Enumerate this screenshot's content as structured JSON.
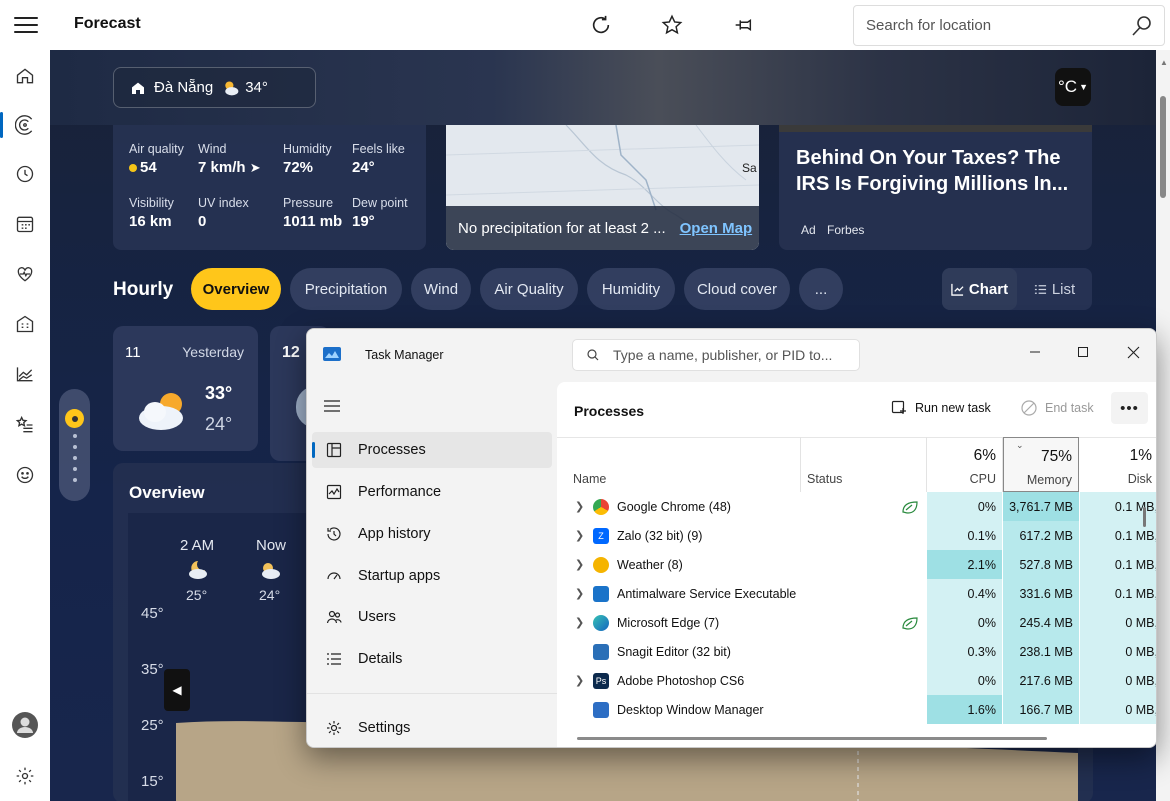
{
  "app": {
    "title": "Forecast"
  },
  "search": {
    "placeholder": "Search for location"
  },
  "location": {
    "name": "Đà Nẵng",
    "temp": "34°"
  },
  "unit": {
    "label": "°C"
  },
  "metrics": [
    {
      "label": "Air quality",
      "value": "54"
    },
    {
      "label": "Wind",
      "value": "7 km/h"
    },
    {
      "label": "Humidity",
      "value": "72%"
    },
    {
      "label": "Feels like",
      "value": "24°"
    },
    {
      "label": "Visibility",
      "value": "16 km"
    },
    {
      "label": "UV index",
      "value": "0"
    },
    {
      "label": "Pressure",
      "value": "1011 mb"
    },
    {
      "label": "Dew point",
      "value": "19°"
    }
  ],
  "map": {
    "text": "No precipitation for at least 2 ...",
    "link": "Open Map"
  },
  "news": {
    "headline": "Behind On Your Taxes? The IRS Is Forgiving Millions In...",
    "ad": "Ad",
    "source": "Forbes"
  },
  "hourly": {
    "title": "Hourly",
    "tabs": [
      "Overview",
      "Precipitation",
      "Wind",
      "Air Quality",
      "Humidity",
      "Cloud cover",
      "..."
    ],
    "view": {
      "chart": "Chart",
      "list": "List"
    }
  },
  "daycards": [
    {
      "day": "11",
      "label": "Yesterday",
      "high": "33°",
      "low": "24°"
    },
    {
      "day": "12"
    }
  ],
  "overview": {
    "title": "Overview",
    "hours": [
      {
        "time": "2 AM",
        "temp": "25°"
      },
      {
        "time": "Now",
        "temp": "24°"
      }
    ],
    "yticks": [
      "45°",
      "35°",
      "25°",
      "15°"
    ]
  },
  "taskmanager": {
    "title": "Task Manager",
    "search_placeholder": "Type a name, publisher, or PID to...",
    "nav": [
      "Processes",
      "Performance",
      "App history",
      "Startup apps",
      "Users",
      "Details",
      "Settings"
    ],
    "header": {
      "title": "Processes",
      "run": "Run new task",
      "end": "End task"
    },
    "columns": {
      "name": "Name",
      "status": "Status",
      "cpu": {
        "pct": "6%",
        "cap": "CPU"
      },
      "memory": {
        "pct": "75%",
        "cap": "Memory"
      },
      "disk": {
        "pct": "1%",
        "cap": "Disk"
      }
    },
    "rows": [
      {
        "name": "Google Chrome (48)",
        "cpu": "0%",
        "mem": "3,761.7 MB",
        "disk": "0.1 MB,",
        "expand": true,
        "eco": true
      },
      {
        "name": "Zalo (32 bit) (9)",
        "cpu": "0.1%",
        "mem": "617.2 MB",
        "disk": "0.1 MB,",
        "expand": true,
        "eco": false
      },
      {
        "name": "Weather (8)",
        "cpu": "2.1%",
        "mem": "527.8 MB",
        "disk": "0.1 MB,",
        "expand": true,
        "eco": false
      },
      {
        "name": "Antimalware Service Executable",
        "cpu": "0.4%",
        "mem": "331.6 MB",
        "disk": "0.1 MB,",
        "expand": true,
        "eco": false
      },
      {
        "name": "Microsoft Edge (7)",
        "cpu": "0%",
        "mem": "245.4 MB",
        "disk": "0 MB,",
        "expand": true,
        "eco": true
      },
      {
        "name": "Snagit Editor (32 bit)",
        "cpu": "0.3%",
        "mem": "238.1 MB",
        "disk": "0 MB,",
        "expand": false,
        "eco": false
      },
      {
        "name": "Adobe Photoshop CS6",
        "cpu": "0%",
        "mem": "217.6 MB",
        "disk": "0 MB,",
        "expand": true,
        "eco": false
      },
      {
        "name": "Desktop Window Manager",
        "cpu": "1.6%",
        "mem": "166.7 MB",
        "disk": "0 MB,",
        "expand": false,
        "eco": false
      }
    ]
  },
  "colors": {
    "accent": "#0067c0",
    "tab_active": "#ffc61a",
    "heat_light": "#d3f1f3",
    "heat_mid": "#b7e9ec",
    "heat_strong": "#9ee0e4"
  }
}
